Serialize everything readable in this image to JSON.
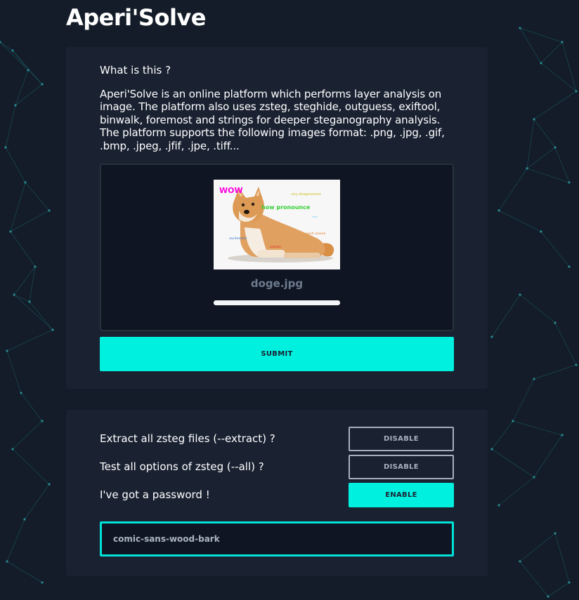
{
  "app": {
    "title": "Aperi'Solve"
  },
  "intro": {
    "heading": "What is this ?",
    "description": "Aperi'Solve is an online platform which performs layer analysis on image. The platform also uses zsteg, steghide, outguess, exiftool, binwalk, foremost and strings for deeper steganography analysis. The platform supports the following images format: .png, .jpg, .gif, .bmp, .jpeg, .jfif, .jpe, .tiff..."
  },
  "upload": {
    "filename": "doge.jpg",
    "progress": 1.0,
    "preview": {
      "texts": [
        "WOW",
        "very disagreement",
        "how pronounce",
        "such unsure",
        "excitement",
        "wow",
        "concern"
      ]
    },
    "submit_label": "SUBMIT"
  },
  "options": [
    {
      "label": "Extract all zsteg files (--extract) ?",
      "button": "DISABLE",
      "state": "off"
    },
    {
      "label": "Test all options of zsteg (--all) ?",
      "button": "DISABLE",
      "state": "off"
    },
    {
      "label": "I've got a password !",
      "button": "ENABLE",
      "state": "on"
    }
  ],
  "password": {
    "value": "comic-sans-wood-bark"
  },
  "colors": {
    "background": "#131c28",
    "card": "#1a2232",
    "accent": "#00f0e0",
    "network_lines": "#1b5a62"
  }
}
